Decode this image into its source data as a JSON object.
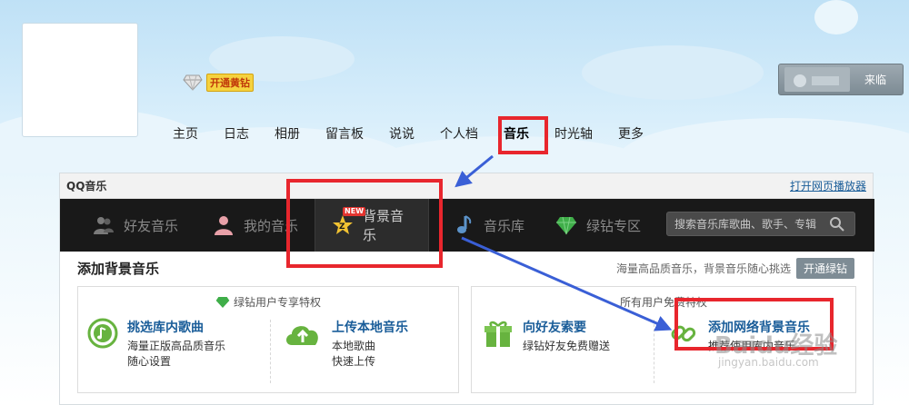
{
  "header": {
    "vip_badge": "开通黄钻",
    "visitor_label": "来临"
  },
  "nav": {
    "items": [
      {
        "label": "主页"
      },
      {
        "label": "日志"
      },
      {
        "label": "相册"
      },
      {
        "label": "留言板"
      },
      {
        "label": "说说"
      },
      {
        "label": "个人档"
      },
      {
        "label": "音乐"
      },
      {
        "label": "时光轴"
      },
      {
        "label": "更多"
      }
    ],
    "active_index": 6
  },
  "panel": {
    "title": "QQ音乐",
    "open_player_link": "打开网页播放器",
    "music_tabs": [
      {
        "label": "好友音乐",
        "icon": "friends-icon"
      },
      {
        "label": "我的音乐",
        "icon": "user-icon"
      },
      {
        "label": "背景音乐",
        "icon": "star-icon",
        "badge": "NEW"
      },
      {
        "label": "音乐库",
        "icon": "note-icon"
      },
      {
        "label": "绿钻专区",
        "icon": "green-diamond-icon"
      }
    ],
    "search_placeholder": "搜索音乐库歌曲、歌手、专辑",
    "section_title": "添加背景音乐",
    "section_hint": "海量高品质音乐，背景音乐随心挑选",
    "open_green_button": "开通绿钻",
    "left_card": {
      "caption": "绿钻用户专享特权",
      "options": [
        {
          "title": "挑选库内歌曲",
          "desc1": "海量正版高品质音乐",
          "desc2": "随心设置"
        },
        {
          "title": "上传本地音乐",
          "desc1": "本地歌曲",
          "desc2": "快速上传"
        }
      ]
    },
    "right_card": {
      "caption": "所有用户免费特权",
      "options": [
        {
          "title": "向好友索要",
          "desc1": "绿钻好友免费赠送",
          "desc2": ""
        },
        {
          "title": "添加网络背景音乐",
          "desc1": "",
          "desc2": "推荐使用库内音乐"
        }
      ]
    }
  },
  "watermark": {
    "text": "Baidu经验",
    "sub": "jingyan.baidu.com"
  },
  "colors": {
    "highlight": "#e8262d",
    "arrow": "#3a5fd6",
    "link": "#1a5d99",
    "music_bar": "#191919"
  }
}
